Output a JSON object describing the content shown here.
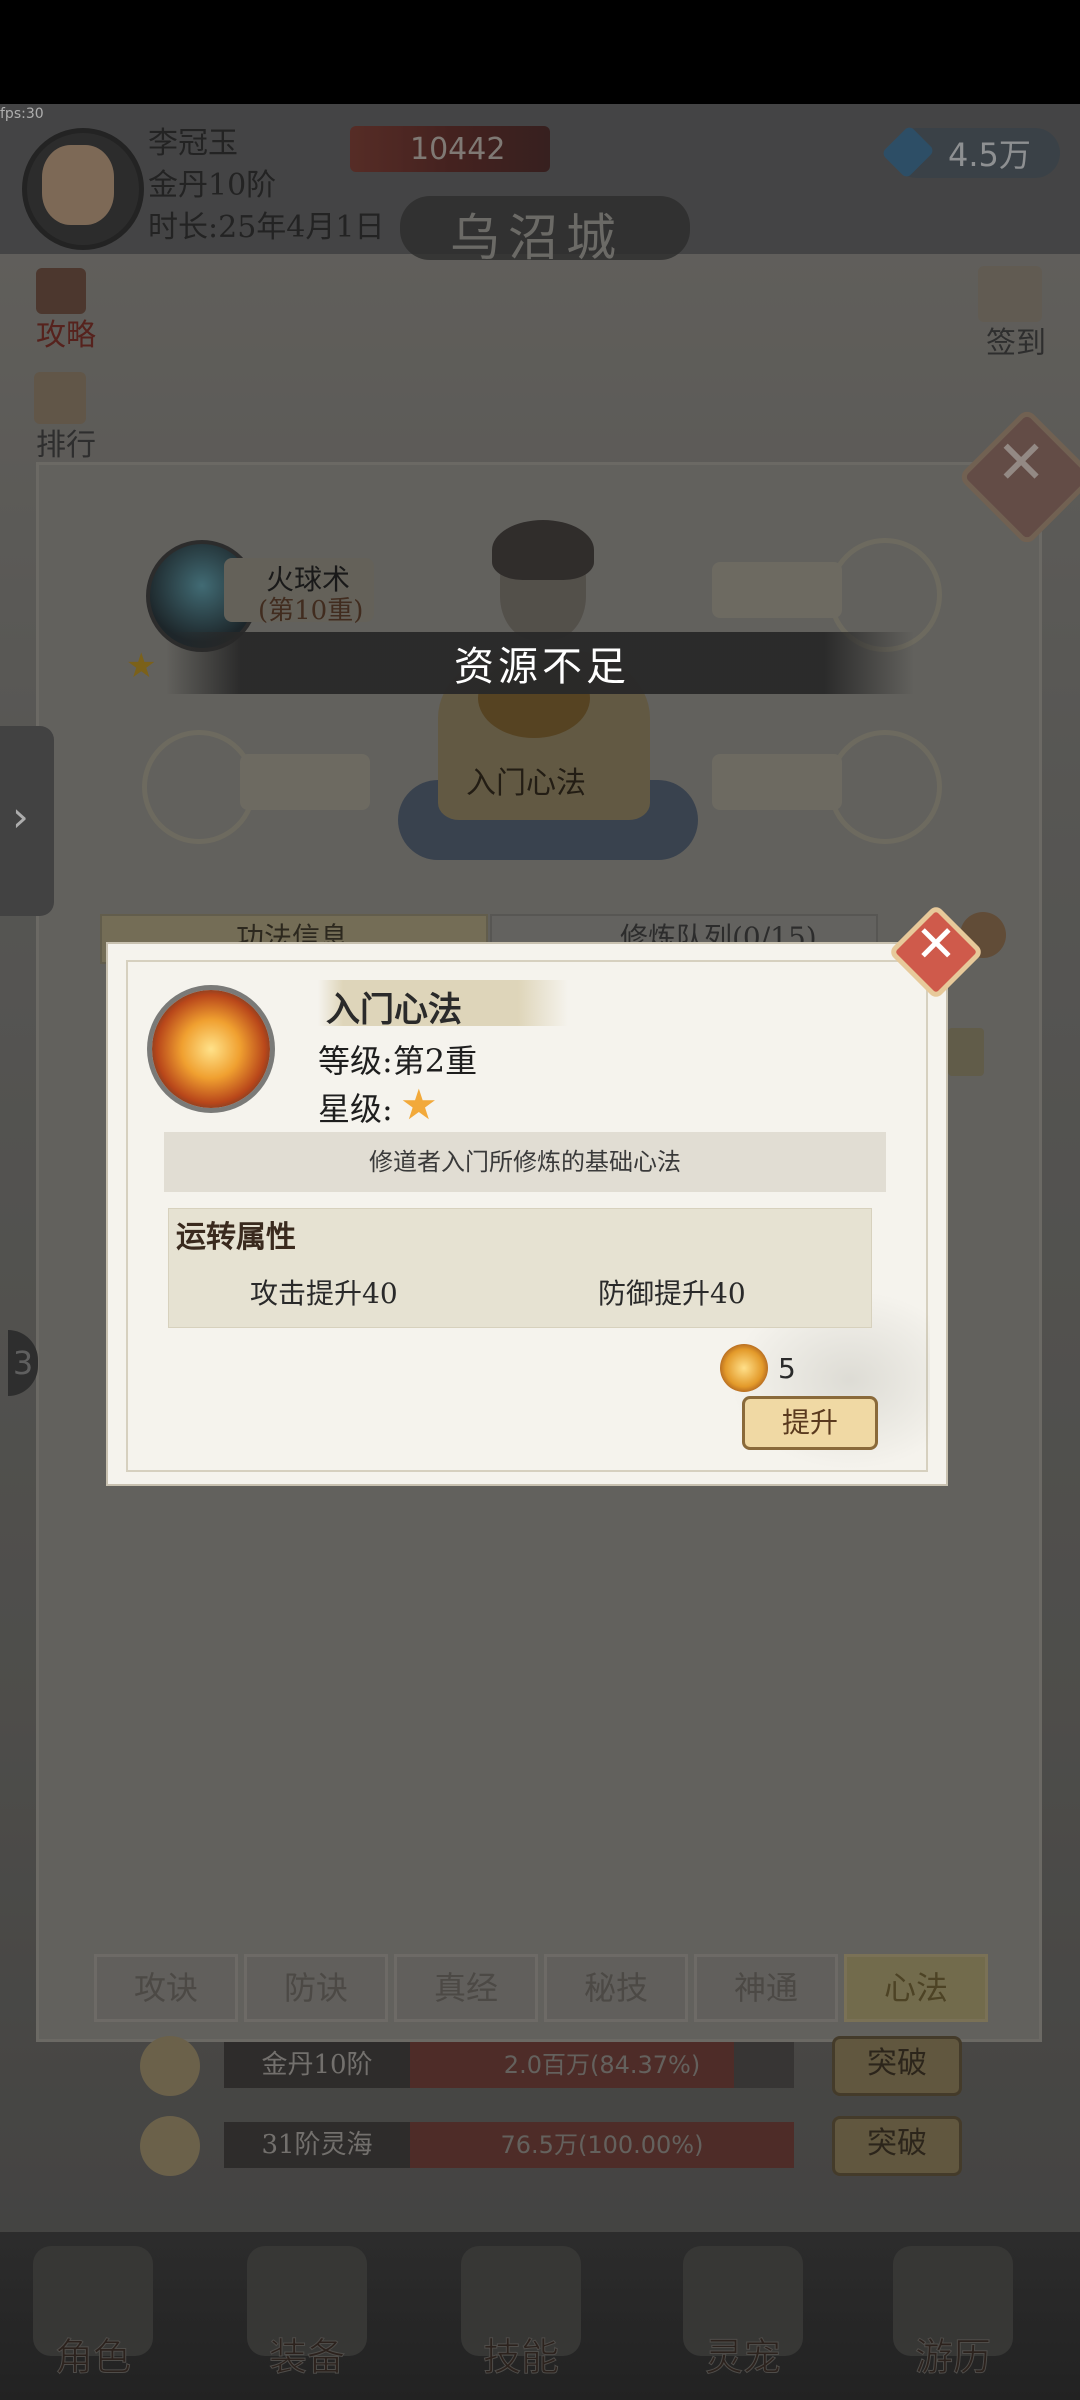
{
  "debug": {
    "fps": "fps:30"
  },
  "header": {
    "player_name": "李冠玉",
    "player_rank": "金丹10阶",
    "play_time": "时长:25年4月1日",
    "power_value": "10442",
    "gem_value": "4.5万",
    "city_name": "乌沼城"
  },
  "side_buttons": {
    "strategy": "攻略",
    "ranking": "排行",
    "sign_in": "签到"
  },
  "cultivation": {
    "skill_name": "火球术",
    "skill_level": "(第10重)",
    "center_skill": "入门心法"
  },
  "toast": {
    "message": "资源不足"
  },
  "panel_tabs": {
    "info": "功法信息",
    "queue": "修炼队列(0/15)"
  },
  "left_peek": "3",
  "categories": [
    {
      "label": "攻诀",
      "active": false
    },
    {
      "label": "防诀",
      "active": false
    },
    {
      "label": "真经",
      "active": false
    },
    {
      "label": "秘技",
      "active": false
    },
    {
      "label": "神通",
      "active": false
    },
    {
      "label": "心法",
      "active": true
    }
  ],
  "realms": [
    {
      "label": "金丹10阶",
      "value": "2.0百万(84.37%)",
      "progress": 0.8437,
      "button": "突破"
    },
    {
      "label": "31阶灵海",
      "value": "76.5万(100.00%)",
      "progress": 1.0,
      "button": "突破"
    }
  ],
  "bottom_nav": [
    {
      "label": "角色",
      "icon": "character-icon"
    },
    {
      "label": "装备",
      "icon": "equipment-icon"
    },
    {
      "label": "技能",
      "icon": "skill-icon"
    },
    {
      "label": "灵宠",
      "icon": "pet-icon"
    },
    {
      "label": "游历",
      "icon": "travel-icon"
    }
  ],
  "dialog": {
    "title": "入门心法",
    "level_label": "等级:第2重",
    "star_label": "星级:",
    "star_count": 1,
    "description": "修道者入门所修炼的基础心法",
    "attr_title": "运转属性",
    "attr_attack": "攻击提升40",
    "attr_defense": "防御提升40",
    "cost_value": "5",
    "upgrade_button": "提升"
  },
  "colors": {
    "star": "#f2a93a",
    "close_button": "#cf5a4b",
    "upgrade_button_bg": "#f0d9a4"
  }
}
